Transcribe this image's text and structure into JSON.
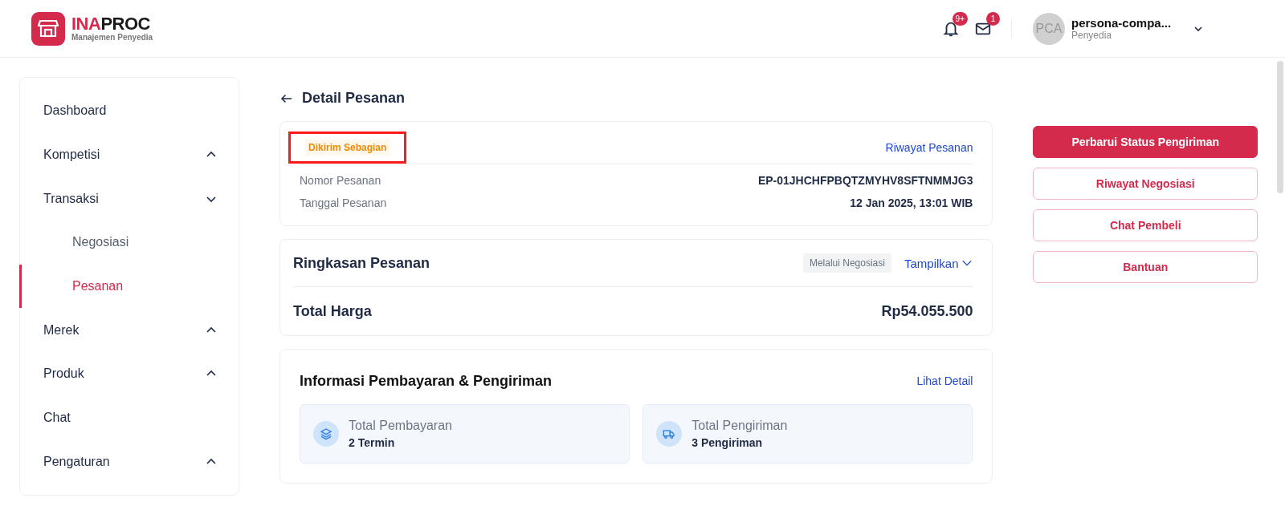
{
  "brand": {
    "name_highlight": "INA",
    "name_rest": "PROC",
    "subtitle": "Manajemen Penyedia"
  },
  "header": {
    "notifications_badge": "9+",
    "messages_badge": "1",
    "avatar_initials": "PCA",
    "user_name": "persona-compa...",
    "user_role": "Penyedia"
  },
  "sidebar": {
    "items": [
      {
        "label": "Dashboard",
        "selected": false
      },
      {
        "label": "Kompetisi",
        "selected": false,
        "expanded": false
      },
      {
        "label": "Transaksi",
        "selected": false,
        "expanded": true,
        "children": [
          {
            "label": "Negosiasi",
            "selected": false
          },
          {
            "label": "Pesanan",
            "selected": true
          }
        ]
      },
      {
        "label": "Merek",
        "selected": false,
        "expanded": false
      },
      {
        "label": "Produk",
        "selected": false,
        "expanded": false
      },
      {
        "label": "Chat",
        "selected": false
      },
      {
        "label": "Pengaturan",
        "selected": false,
        "expanded": false
      }
    ]
  },
  "page_title": "Detail Pesanan",
  "order": {
    "status": "Dikirim Sebagian",
    "status_highlighted": true,
    "history_link": "Riwayat Pesanan",
    "fields": [
      {
        "label": "Nomor Pesanan",
        "value": "EP-01JHCHFPBQTZMYHV8SFTNMMJG3"
      },
      {
        "label": "Tanggal Pesanan",
        "value": "12 Jan 2025, 13:01 WIB"
      }
    ]
  },
  "summary": {
    "title": "Ringkasan Pesanan",
    "tag": "Melalui Negosiasi",
    "toggle": "Tampilkan",
    "total_label": "Total Harga",
    "total_value": "Rp54.055.500"
  },
  "payment_shipping": {
    "title": "Informasi Pembayaran & Pengiriman",
    "link": "Lihat Detail",
    "tiles": [
      {
        "kind": "payment",
        "label": "Total Pembayaran",
        "value": "2 Termin"
      },
      {
        "kind": "shipping",
        "label": "Total Pengiriman",
        "value": "3 Pengiriman"
      }
    ]
  },
  "actions": [
    {
      "label": "Perbarui Status Pengiriman",
      "kind": "primary"
    },
    {
      "label": "Riwayat Negosiasi",
      "kind": "secondary"
    },
    {
      "label": "Chat Pembeli",
      "kind": "secondary"
    },
    {
      "label": "Bantuan",
      "kind": "secondary"
    }
  ]
}
